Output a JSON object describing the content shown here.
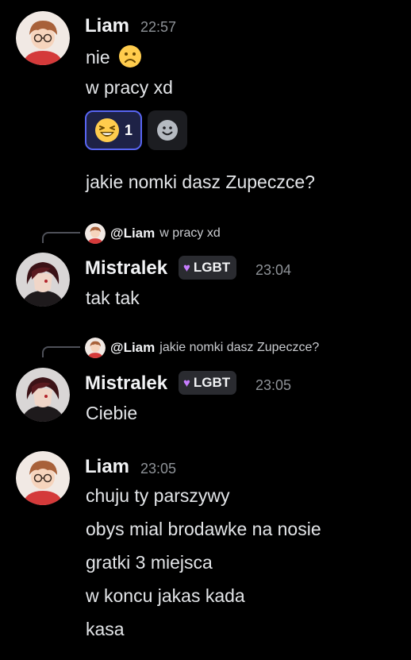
{
  "messages": [
    {
      "author": "Liam",
      "time": "22:57",
      "lines": [
        "nie",
        "w pracy xd"
      ],
      "reactions": [
        {
          "emoji": "laughing",
          "count": "1"
        }
      ],
      "extra": "jakie nomki dasz Zupeczce?"
    },
    {
      "author": "Mistralek",
      "tag": "LGBT",
      "time": "23:04",
      "reply": {
        "mention": "@Liam",
        "text": "w pracy xd"
      },
      "lines": [
        "tak tak"
      ]
    },
    {
      "author": "Mistralek",
      "tag": "LGBT",
      "time": "23:05",
      "reply": {
        "mention": "@Liam",
        "text": "jakie nomki dasz Zupeczce?"
      },
      "lines": [
        "Ciebie"
      ]
    },
    {
      "author": "Liam",
      "time": "23:05",
      "lines": [
        "chuju ty parszywy",
        "obys mial brodawke na nosie",
        "gratki 3 miejsca",
        "w koncu jakas kada",
        "kasa"
      ]
    }
  ],
  "icons": {
    "sad_emoji": "slightly-frowning-face",
    "reaction_emoji": "laughing-face",
    "add_reaction": "add-reaction-smiley",
    "tag_heart": "purple-heart"
  },
  "colors": {
    "background": "#000000",
    "reaction_border": "#5865f2",
    "tag_heart": "#c77dff"
  }
}
